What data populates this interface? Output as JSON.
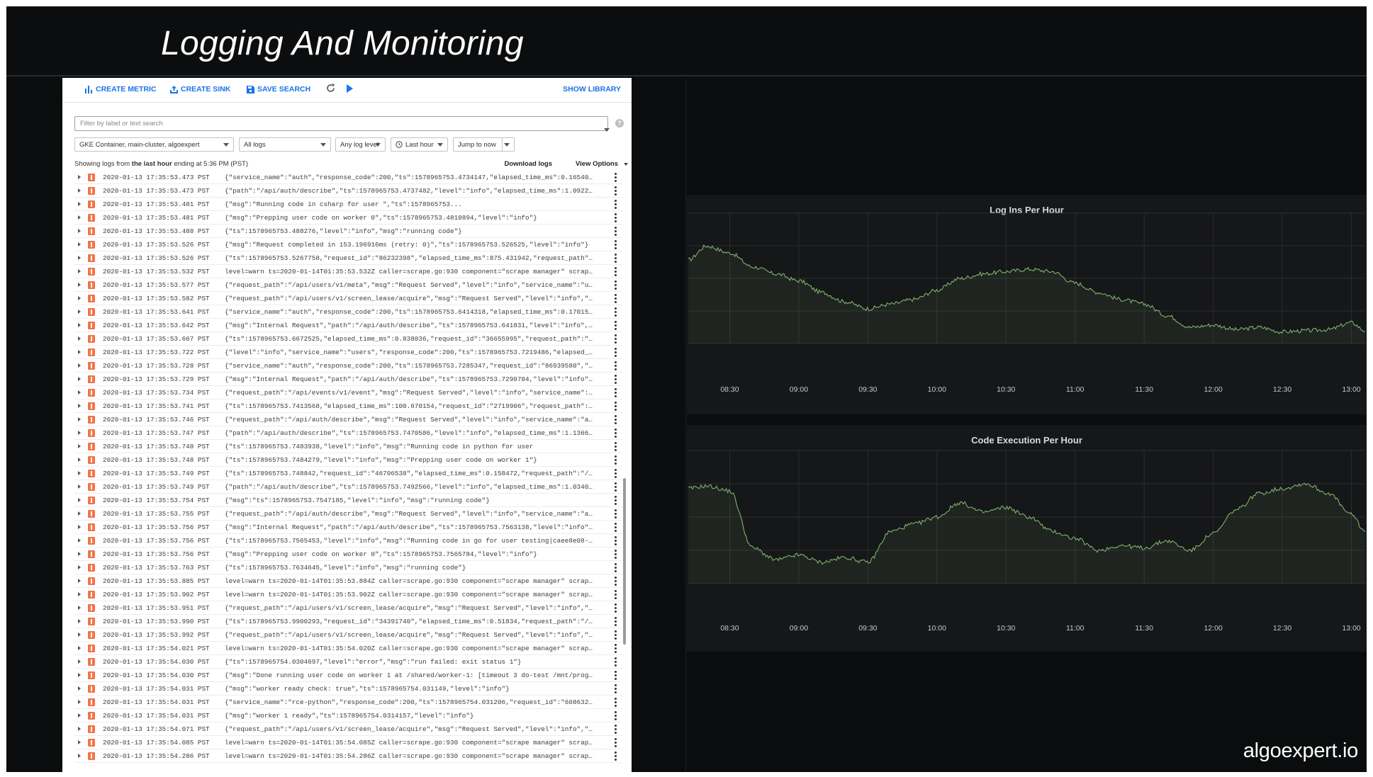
{
  "slide": {
    "title": "Logging And Monitoring",
    "brand": "algoexpert.io"
  },
  "toolbar": {
    "create_metric": "CREATE METRIC",
    "create_sink": "CREATE SINK",
    "save_search": "SAVE SEARCH",
    "show_library": "SHOW LIBRARY"
  },
  "filter": {
    "placeholder": "Filter by label or text search"
  },
  "dropdowns": {
    "resource": "GKE Container, main-cluster, algoexpert",
    "logs": "All logs",
    "level": "Any log level",
    "time": "Last hour",
    "jump": "Jump to now"
  },
  "status": {
    "prefix": "Showing logs from ",
    "range": "the last hour",
    "suffix": " ending at 5:36 PM (PST)",
    "download": "Download logs",
    "view_options": "View Options"
  },
  "logs": [
    {
      "ts": "2020-01-13 17:35:53.473 PST",
      "msg": "{\"service_name\":\"auth\",\"response_code\":200,\"ts\":1578965753.4734147,\"elapsed_time_ms\":0.165404..."
    },
    {
      "ts": "2020-01-13 17:35:53.473 PST",
      "msg": "{\"path\":\"/api/auth/describe\",\"ts\":1578965753.4737482,\"level\":\"info\",\"elapsed_time_ms\":1.09223..."
    },
    {
      "ts": "2020-01-13 17:35:53.481 PST",
      "msg": "{\"msg\":\"Running code in csharp for user                                 \",\"ts\":1578965753..."
    },
    {
      "ts": "2020-01-13 17:35:53.481 PST",
      "msg": "{\"msg\":\"Prepping user code on worker 0\",\"ts\":1578965753.4810894,\"level\":\"info\"}"
    },
    {
      "ts": "2020-01-13 17:35:53.488 PST",
      "msg": "{\"ts\":1578965753.488276,\"level\":\"info\",\"msg\":\"running code\"}"
    },
    {
      "ts": "2020-01-13 17:35:53.526 PST",
      "msg": "{\"msg\":\"Request completed in 153.196916ms (retry: 0)\",\"ts\":1578965753.526525,\"level\":\"info\"}"
    },
    {
      "ts": "2020-01-13 17:35:53.526 PST",
      "msg": "{\"ts\":1578965753.5267758,\"request_id\":\"86232398\",\"elapsed_time_ms\":875.431942,\"request_path\":..."
    },
    {
      "ts": "2020-01-13 17:35:53.532 PST",
      "msg": "level=warn ts=2020-01-14T01:35:53.532Z caller=scrape.go:930 component=\"scrape manager\" scrape..."
    },
    {
      "ts": "2020-01-13 17:35:53.577 PST",
      "msg": "{\"request_path\":\"/api/users/v1/meta\",\"msg\":\"Request Served\",\"level\":\"info\",\"service_name\":\"us..."
    },
    {
      "ts": "2020-01-13 17:35:53.582 PST",
      "msg": "{\"request_path\":\"/api/users/v1/screen_lease/acquire\",\"msg\":\"Request Served\",\"level\":\"info\",\"s..."
    },
    {
      "ts": "2020-01-13 17:35:53.641 PST",
      "msg": "{\"service_name\":\"auth\",\"response_code\":200,\"ts\":1578965753.6414318,\"elapsed_time_ms\":0.170159..."
    },
    {
      "ts": "2020-01-13 17:35:53.642 PST",
      "msg": "{\"msg\":\"Internal Request\",\"path\":\"/api/auth/describe\",\"ts\":1578965753.641831,\"level\":\"info\",\"..."
    },
    {
      "ts": "2020-01-13 17:35:53.667 PST",
      "msg": "{\"ts\":1578965753.6672525,\"elapsed_time_ms\":0.838036,\"request_id\":\"36655995\",\"request_path\":\"/..."
    },
    {
      "ts": "2020-01-13 17:35:53.722 PST",
      "msg": "{\"level\":\"info\",\"service_name\":\"users\",\"response_code\":200,\"ts\":1578965753.7219486,\"elapsed_t..."
    },
    {
      "ts": "2020-01-13 17:35:53.728 PST",
      "msg": "{\"service_name\":\"auth\",\"response_code\":200,\"ts\":1578965753.7285347,\"request_id\":\"86939580\",\"e..."
    },
    {
      "ts": "2020-01-13 17:35:53.729 PST",
      "msg": "{\"msg\":\"Internal Request\",\"path\":\"/api/auth/describe\",\"ts\":1578965753.7290704,\"level\":\"info\",..."
    },
    {
      "ts": "2020-01-13 17:35:53.734 PST",
      "msg": "{\"request_path\":\"/api/events/v1/event\",\"msg\":\"Request Served\",\"level\":\"info\",\"service_name\":..."
    },
    {
      "ts": "2020-01-13 17:35:53.741 PST",
      "msg": "{\"ts\":1578965753.7413568,\"elapsed_time_ms\":100.670154,\"request_id\":\"2719906\",\"request_path\":\"..."
    },
    {
      "ts": "2020-01-13 17:35:53.746 PST",
      "msg": "{\"request_path\":\"/api/auth/describe\",\"msg\":\"Request Served\",\"level\":\"info\",\"service_name\":\"au..."
    },
    {
      "ts": "2020-01-13 17:35:53.747 PST",
      "msg": "{\"path\":\"/api/auth/describe\",\"ts\":1578965753.7470586,\"level\":\"info\",\"elapsed_time_ms\":1.13663..."
    },
    {
      "ts": "2020-01-13 17:35:53.748 PST",
      "msg": "{\"ts\":1578965753.7483938,\"level\":\"info\",\"msg\":\"Running code in python for user"
    },
    {
      "ts": "2020-01-13 17:35:53.748 PST",
      "msg": "{\"ts\":1578965753.7484279,\"level\":\"info\",\"msg\":\"Prepping user code on worker 1\"}"
    },
    {
      "ts": "2020-01-13 17:35:53.749 PST",
      "msg": "{\"ts\":1578965753.748842,\"request_id\":\"46706538\",\"elapsed_time_ms\":0.158472,\"request_path\":\"/a..."
    },
    {
      "ts": "2020-01-13 17:35:53.749 PST",
      "msg": "{\"path\":\"/api/auth/describe\",\"ts\":1578965753.7492566,\"level\":\"info\",\"elapsed_time_ms\":1.03406..."
    },
    {
      "ts": "2020-01-13 17:35:53.754 PST",
      "msg": "{\"msg\":\"ts\":1578965753.7547185,\"level\":\"info\",\"msg\":\"running code\"}"
    },
    {
      "ts": "2020-01-13 17:35:53.755 PST",
      "msg": "{\"request_path\":\"/api/auth/describe\",\"msg\":\"Request Served\",\"level\":\"info\",\"service_name\":\"au..."
    },
    {
      "ts": "2020-01-13 17:35:53.756 PST",
      "msg": "{\"msg\":\"Internal Request\",\"path\":\"/api/auth/describe\",\"ts\":1578965753.7563138,\"level\":\"info\",..."
    },
    {
      "ts": "2020-01-13 17:35:53.756 PST",
      "msg": "{\"ts\":1578965753.7565453,\"level\":\"info\",\"msg\":\"Running code in go for user testing|caee8e08-7..."
    },
    {
      "ts": "2020-01-13 17:35:53.756 PST",
      "msg": "{\"msg\":\"Prepping user code on worker 0\",\"ts\":1578965753.7565784,\"level\":\"info\"}"
    },
    {
      "ts": "2020-01-13 17:35:53.763 PST",
      "msg": "{\"ts\":1578965753.7634645,\"level\":\"info\",\"msg\":\"running code\"}"
    },
    {
      "ts": "2020-01-13 17:35:53.885 PST",
      "msg": "level=warn ts=2020-01-14T01:35:53.884Z caller=scrape.go:930 component=\"scrape manager\" scrape..."
    },
    {
      "ts": "2020-01-13 17:35:53.902 PST",
      "msg": "level=warn ts=2020-01-14T01:35:53.902Z caller=scrape.go:930 component=\"scrape manager\" scrape..."
    },
    {
      "ts": "2020-01-13 17:35:53.951 PST",
      "msg": "{\"request_path\":\"/api/users/v1/screen_lease/acquire\",\"msg\":\"Request Served\",\"level\":\"info\",\"s..."
    },
    {
      "ts": "2020-01-13 17:35:53.990 PST",
      "msg": "{\"ts\":1578965753.9900293,\"request_id\":\"34391740\",\"elapsed_time_ms\":0.51834,\"request_path\":\"/a..."
    },
    {
      "ts": "2020-01-13 17:35:53.992 PST",
      "msg": "{\"request_path\":\"/api/users/v1/screen_lease/acquire\",\"msg\":\"Request Served\",\"level\":\"info\",\"s..."
    },
    {
      "ts": "2020-01-13 17:35:54.021 PST",
      "msg": "level=warn ts=2020-01-14T01:35:54.020Z caller=scrape.go:930 component=\"scrape manager\" scrape..."
    },
    {
      "ts": "2020-01-13 17:35:54.030 PST",
      "msg": "{\"ts\":1578965754.0304697,\"level\":\"error\",\"msg\":\"run failed: exit status 1\"}"
    },
    {
      "ts": "2020-01-13 17:35:54.030 PST",
      "msg": "{\"msg\":\"Done running user code on worker 1 at /shared/worker-1: [timeout 3 do-test /mnt/progr..."
    },
    {
      "ts": "2020-01-13 17:35:54.031 PST",
      "msg": "{\"msg\":\"worker ready check: true\",\"ts\":1578965754.031149,\"level\":\"info\"}"
    },
    {
      "ts": "2020-01-13 17:35:54.031 PST",
      "msg": "{\"service_name\":\"rce-python\",\"response_code\":200,\"ts\":1578965754.031206,\"request_id\":\"6086324..."
    },
    {
      "ts": "2020-01-13 17:35:54.031 PST",
      "msg": "{\"msg\":\"worker 1 ready\",\"ts\":1578965754.0314157,\"level\":\"info\"}"
    },
    {
      "ts": "2020-01-13 17:35:54.071 PST",
      "msg": "{\"request_path\":\"/api/users/v1/screen_lease/acquire\",\"msg\":\"Request Served\",\"level\":\"info\",\"s..."
    },
    {
      "ts": "2020-01-13 17:35:54.085 PST",
      "msg": "level=warn ts=2020-01-14T01:35:54.085Z caller=scrape.go:930 component=\"scrape manager\" scrape..."
    },
    {
      "ts": "2020-01-13 17:35:54.286 PST",
      "msg": "level=warn ts=2020-01-14T01:35:54.286Z caller=scrape.go:930 component=\"scrape manager\" scrape..."
    }
  ],
  "chart_data": [
    {
      "type": "line",
      "title": "Log Ins Per Hour",
      "x": [
        "08:12",
        "08:20",
        "08:30",
        "08:40",
        "08:50",
        "09:00",
        "09:10",
        "09:20",
        "09:30",
        "09:40",
        "09:50",
        "10:00",
        "10:10",
        "10:20",
        "10:30",
        "10:40",
        "10:50",
        "11:00",
        "11:10",
        "11:20",
        "11:30",
        "11:40",
        "11:50",
        "12:00",
        "12:10",
        "12:20",
        "12:30",
        "12:40",
        "12:50",
        "13:00",
        "13:06"
      ],
      "values": [
        0.72,
        0.84,
        0.78,
        0.66,
        0.6,
        0.54,
        0.44,
        0.36,
        0.3,
        0.34,
        0.38,
        0.46,
        0.56,
        0.6,
        0.62,
        0.64,
        0.62,
        0.52,
        0.44,
        0.38,
        0.34,
        0.24,
        0.14,
        0.16,
        0.12,
        0.14,
        0.1,
        0.11,
        0.12,
        0.18,
        0.11
      ],
      "xticks": [
        "08:30",
        "09:00",
        "09:30",
        "10:00",
        "10:30",
        "11:00",
        "11:30",
        "12:00",
        "12:30",
        "13:00"
      ],
      "color": "#7eb26d",
      "grid": true
    },
    {
      "type": "line",
      "title": "Code Execution Per Hour",
      "x": [
        "08:12",
        "08:20",
        "08:30",
        "08:40",
        "08:50",
        "09:00",
        "09:10",
        "09:20",
        "09:30",
        "09:40",
        "09:50",
        "10:00",
        "10:10",
        "10:20",
        "10:30",
        "10:40",
        "10:50",
        "11:00",
        "11:10",
        "11:20",
        "11:30",
        "11:40",
        "11:50",
        "12:00",
        "12:10",
        "12:20",
        "12:30",
        "12:40",
        "12:50",
        "13:00",
        "13:06"
      ],
      "values": [
        0.8,
        0.82,
        0.78,
        0.3,
        0.2,
        0.24,
        0.18,
        0.22,
        0.18,
        0.44,
        0.5,
        0.56,
        0.68,
        0.6,
        0.64,
        0.56,
        0.44,
        0.38,
        0.28,
        0.32,
        0.3,
        0.36,
        0.28,
        0.42,
        0.62,
        0.76,
        0.8,
        0.84,
        0.76,
        0.58,
        0.44
      ],
      "xticks": [
        "08:30",
        "09:00",
        "09:30",
        "10:00",
        "10:30",
        "11:00",
        "11:30",
        "12:00",
        "12:30",
        "13:00"
      ],
      "color": "#7eb26d",
      "grid": true
    }
  ]
}
